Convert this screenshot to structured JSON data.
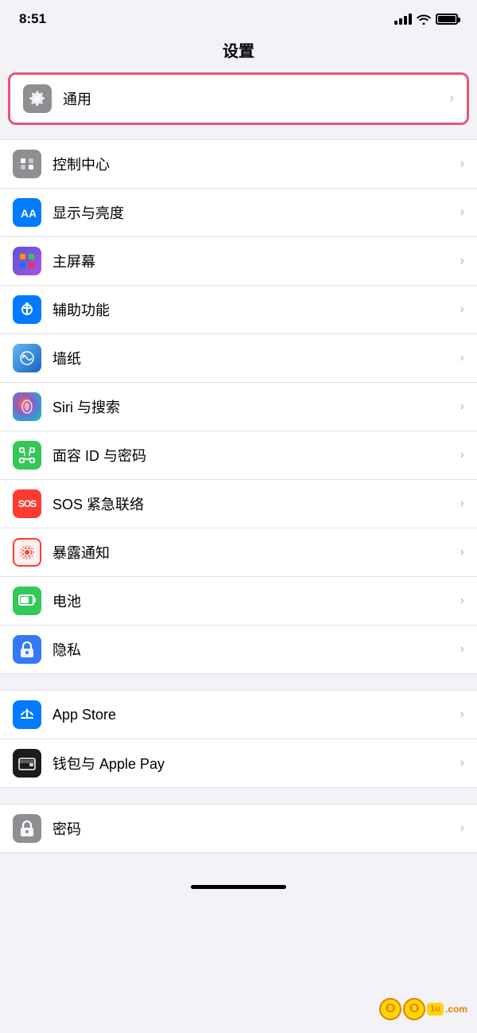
{
  "statusBar": {
    "time": "8:51",
    "signal": "signal",
    "wifi": "wifi",
    "battery": "battery"
  },
  "pageTitle": "设置",
  "sections": [
    {
      "highlighted": true,
      "items": [
        {
          "id": "general",
          "label": "通用",
          "iconColor": "icon-gray",
          "iconType": "gear"
        }
      ]
    },
    {
      "highlighted": false,
      "items": [
        {
          "id": "control-center",
          "label": "控制中心",
          "iconColor": "icon-gray",
          "iconType": "control"
        },
        {
          "id": "display",
          "label": "显示与亮度",
          "iconColor": "icon-blue",
          "iconType": "display"
        },
        {
          "id": "home-screen",
          "label": "主屏幕",
          "iconColor": "icon-purple",
          "iconType": "homescreen"
        },
        {
          "id": "accessibility",
          "label": "辅助功能",
          "iconColor": "icon-blue",
          "iconType": "accessibility"
        },
        {
          "id": "wallpaper",
          "label": "墙纸",
          "iconColor": "icon-teal",
          "iconType": "wallpaper"
        },
        {
          "id": "siri",
          "label": "Siri 与搜索",
          "iconColor": "icon-siri",
          "iconType": "siri"
        },
        {
          "id": "faceid",
          "label": "面容 ID 与密码",
          "iconColor": "icon-green",
          "iconType": "faceid"
        },
        {
          "id": "sos",
          "label": "SOS 紧急联络",
          "iconColor": "sos-icon",
          "iconType": "sos"
        },
        {
          "id": "exposure",
          "label": "暴露通知",
          "iconColor": "icon-red",
          "iconType": "exposure"
        },
        {
          "id": "battery",
          "label": "电池",
          "iconColor": "icon-green",
          "iconType": "battery"
        },
        {
          "id": "privacy",
          "label": "隐私",
          "iconColor": "icon-blue",
          "iconType": "privacy"
        }
      ]
    },
    {
      "highlighted": false,
      "items": [
        {
          "id": "appstore",
          "label": "App Store",
          "iconColor": "icon-blue",
          "iconType": "appstore"
        },
        {
          "id": "wallet",
          "label": "钱包与 Apple Pay",
          "iconColor": "icon-black",
          "iconType": "wallet"
        }
      ]
    },
    {
      "highlighted": false,
      "items": [
        {
          "id": "passwords",
          "label": "密码",
          "iconColor": "icon-gray",
          "iconType": "passwords"
        }
      ]
    }
  ],
  "watermark": "oo1u.com"
}
